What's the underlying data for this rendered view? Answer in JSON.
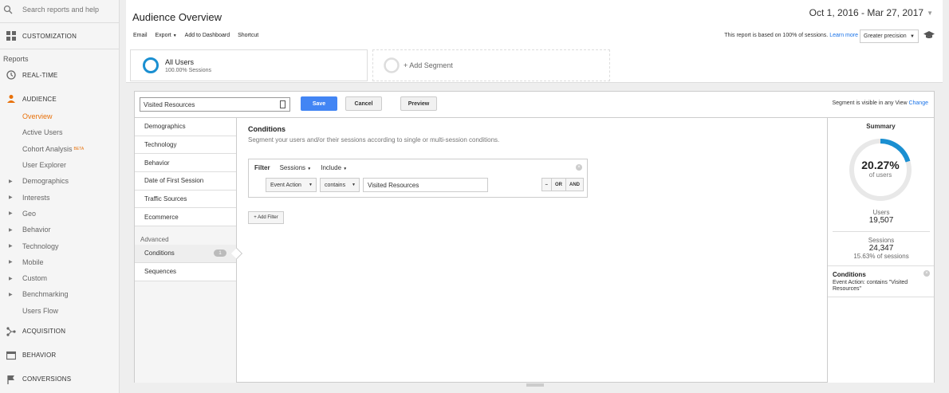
{
  "nav": {
    "search_placeholder": "Search reports and help",
    "customization": "CUSTOMIZATION",
    "reports_label": "Reports",
    "realtime": "REAL-TIME",
    "audience": "AUDIENCE",
    "audience_items": {
      "overview": "Overview",
      "active_users": "Active Users",
      "cohort": "Cohort Analysis",
      "cohort_badge": "BETA",
      "user_explorer": "User Explorer",
      "demographics": "Demographics",
      "interests": "Interests",
      "geo": "Geo",
      "behavior": "Behavior",
      "technology": "Technology",
      "mobile": "Mobile",
      "custom": "Custom",
      "benchmarking": "Benchmarking",
      "users_flow": "Users Flow"
    },
    "acquisition": "ACQUISITION",
    "behavior": "BEHAVIOR",
    "conversions": "CONVERSIONS"
  },
  "header": {
    "title": "Audience Overview",
    "date_range": "Oct 1, 2016 - Mar 27, 2017",
    "toolbar": {
      "email": "Email",
      "export": "Export",
      "add_dashboard": "Add to Dashboard",
      "shortcut": "Shortcut"
    },
    "report_note": "This report is based on 100% of sessions.",
    "learn_more": "Learn more",
    "precision": "Greater precision"
  },
  "segments": {
    "seg1_name": "All Users",
    "seg1_sub": "100.00% Sessions",
    "add_segment": "+ Add Segment"
  },
  "editor": {
    "segment_name": "Visited Resources",
    "save": "Save",
    "cancel": "Cancel",
    "preview": "Preview",
    "visible_note": "Segment is visible in any View",
    "change": "Change",
    "categories": {
      "demographics": "Demographics",
      "technology": "Technology",
      "behavior": "Behavior",
      "first_session": "Date of First Session",
      "traffic": "Traffic Sources",
      "ecommerce": "Ecommerce",
      "advanced": "Advanced",
      "conditions": "Conditions",
      "conditions_count": "1",
      "sequences": "Sequences"
    },
    "conditions": {
      "title": "Conditions",
      "subtitle": "Segment your users and/or their sessions according to single or multi-session conditions.",
      "filter": "Filter",
      "scope": "Sessions",
      "include": "Include",
      "dimension": "Event Action",
      "operator": "contains",
      "value": "Visited Resources",
      "minus": "–",
      "or": "OR",
      "and": "AND",
      "add_filter": "+ Add Filter"
    },
    "summary": {
      "title": "Summary",
      "percent": "20.27%",
      "percent_value": 0.2027,
      "of_users": "of users",
      "users_label": "Users",
      "users_value": "19,507",
      "sessions_label": "Sessions",
      "sessions_value": "24,347",
      "sessions_pct": "15.63% of sessions",
      "cond_title": "Conditions",
      "cond_desc": "Event Action: contains \"Visited Resources\""
    }
  },
  "colors": {
    "accent": "#e8710a",
    "primary": "#4285f4",
    "ring": "#1a8fd1",
    "ring_segment": "#0b7db8"
  }
}
